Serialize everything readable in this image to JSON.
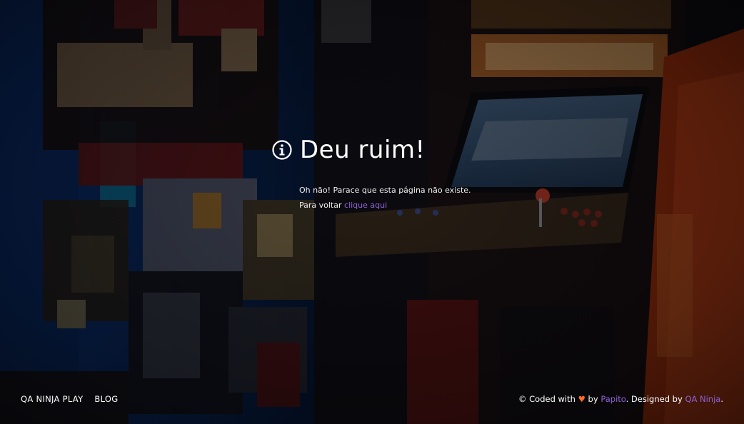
{
  "error": {
    "icon": "info-icon",
    "title": "Deu ruim!",
    "message": "Oh não! Parace que esta página não existe.",
    "back_prefix": "Para voltar",
    "back_link": "clique aqui"
  },
  "footer": {
    "nav": [
      "QA NINJA PLAY",
      "BLOG"
    ],
    "credits": {
      "prefix": "© Coded with",
      "heart": "♥",
      "by": "by",
      "author": "Papito",
      "designed_by": ". Designed by",
      "designer": "QA Ninja",
      "suffix": "."
    }
  },
  "colors": {
    "link": "#8e63d6",
    "heart": "#ff6b2c",
    "text": "#ffffff"
  }
}
